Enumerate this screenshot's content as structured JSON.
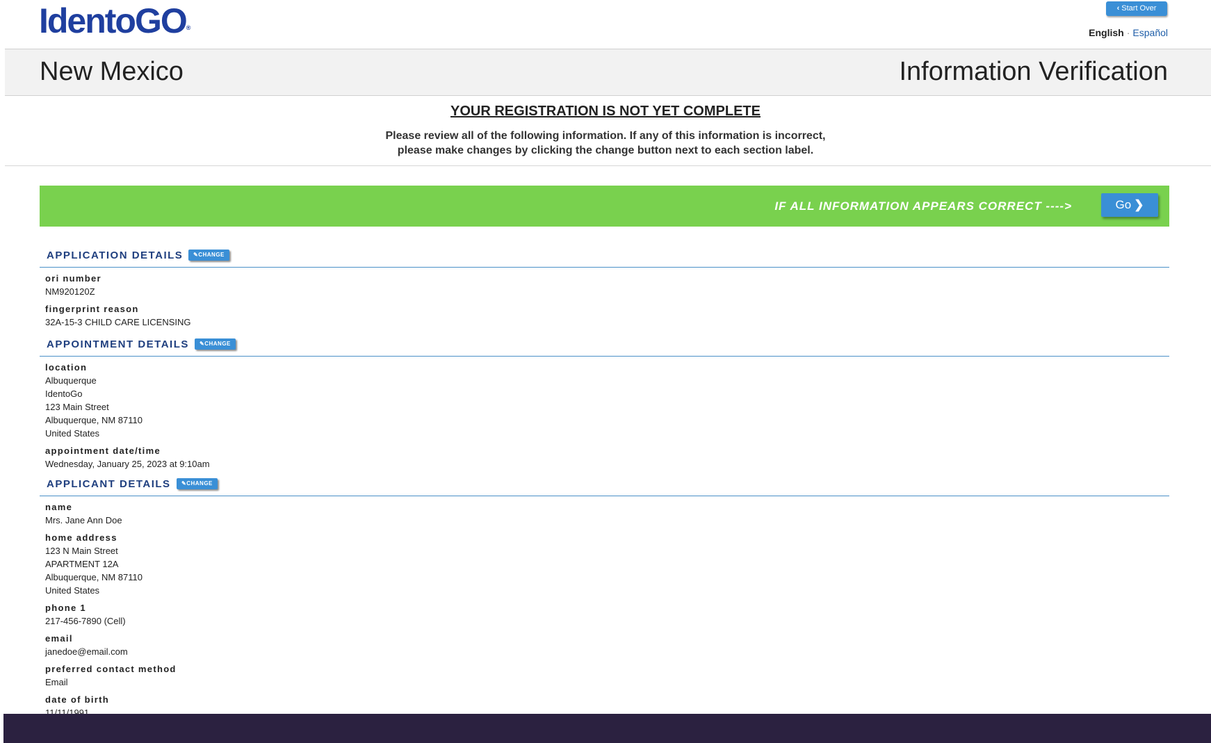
{
  "header": {
    "logo_text": "IdentoGO",
    "logo_mark": "®",
    "start_over_label": "Start Over",
    "lang_english": "English",
    "lang_separator": "·",
    "lang_spanish": "Español"
  },
  "band": {
    "state": "New Mexico",
    "title": "Information Verification"
  },
  "notice": {
    "title": "YOUR REGISTRATION IS NOT YET COMPLETE",
    "line1": "Please review all of the following information. If any of this information is incorrect,",
    "line2": "please make changes by clicking the change button next to each section label."
  },
  "confirm_bar": {
    "text": "IF ALL INFORMATION APPEARS CORRECT ---->",
    "go_label": "Go",
    "color": "#79d14e"
  },
  "change_label": "CHANGE",
  "sections": {
    "application": {
      "title": "APPLICATION DETAILS",
      "fields": [
        {
          "label": "ori number",
          "lines": [
            "NM920120Z"
          ]
        },
        {
          "label": "fingerprint reason",
          "lines": [
            "32A-15-3 CHILD CARE LICENSING"
          ]
        }
      ]
    },
    "appointment": {
      "title": "APPOINTMENT DETAILS",
      "fields": [
        {
          "label": "location",
          "lines": [
            "Albuquerque",
            "IdentoGo",
            "123 Main Street",
            "Albuquerque, NM 87110",
            "United States"
          ]
        },
        {
          "label": "appointment date/time",
          "lines": [
            "Wednesday, January 25, 2023 at 9:10am"
          ]
        }
      ]
    },
    "applicant": {
      "title": "APPLICANT DETAILS",
      "fields": [
        {
          "label": "name",
          "lines": [
            "Mrs. Jane Ann Doe"
          ]
        },
        {
          "label": "home address",
          "lines": [
            "123 N Main Street",
            "APARTMENT 12A",
            "Albuquerque, NM 87110",
            "United States"
          ]
        },
        {
          "label": "phone 1",
          "lines": [
            "217-456-7890 (Cell)"
          ]
        },
        {
          "label": "email",
          "lines": [
            "janedoe@email.com"
          ]
        },
        {
          "label": "preferred contact method",
          "lines": [
            "Email"
          ]
        },
        {
          "label": "date of birth",
          "lines": [
            "11/11/1991"
          ]
        }
      ]
    }
  },
  "icons": {
    "start_over": "chevron-left-icon",
    "go": "chevron-right-icon",
    "change": "pencil-icon"
  },
  "colors": {
    "brand": "#1f3f9f",
    "button": "#3a8fd6",
    "footer": "#2b2140"
  }
}
